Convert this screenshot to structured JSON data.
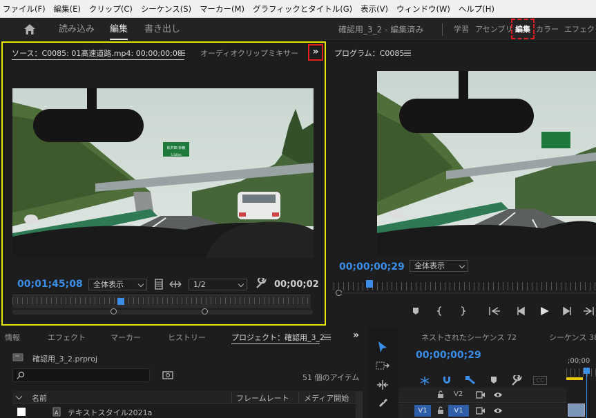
{
  "menu": [
    "ファイル(F)",
    "編集(E)",
    "クリップ(C)",
    "シーケンス(S)",
    "マーカー(M)",
    "グラフィックとタイトル(G)",
    "表示(V)",
    "ウィンドウ(W)",
    "ヘルプ(H)"
  ],
  "workspace": {
    "tabs": [
      "読み込み",
      "編集",
      "書き出し"
    ],
    "active": "編集",
    "project_title": "確認用_3_2 - 編集済み",
    "right_tabs": [
      "学習",
      "アセンブリ",
      "編集",
      "カラー",
      "エフェクト"
    ]
  },
  "source": {
    "tab_active": "ソース：C0085:  01高速道路.mp4: 00;00;00;00",
    "tab_other": "オーディオクリップミキサー",
    "overflow": "»",
    "timecode_left": "00;01;45;08",
    "zoom": "全体表示",
    "resolution": "1/2",
    "timecode_right": "00;00;02",
    "sign_text": "松井田 妙義",
    "sign_sub": "5 500m"
  },
  "program": {
    "tab": "プログラム：C0085",
    "timecode": "00;00;00;29",
    "zoom": "全体表示"
  },
  "project": {
    "tabs": [
      "情報",
      "エフェクト",
      "マーカー",
      "ヒストリー",
      "プロジェクト：確認用_3_2"
    ],
    "file": "確認用_3_2.prproj",
    "item_count": "51 個のアイテム",
    "columns": [
      "名前",
      "フレームレート",
      "メディア開始"
    ],
    "rows": [
      "テキストスタイル2021a"
    ],
    "overflow": "»"
  },
  "timeline": {
    "tabs": [
      "ネストされたシーケンス 72",
      "シーケンス 38"
    ],
    "timecode": "00;00;00;29",
    "ruler": ";00;00",
    "tracks": [
      "V2",
      "V1"
    ],
    "src_patch": "V1"
  }
}
